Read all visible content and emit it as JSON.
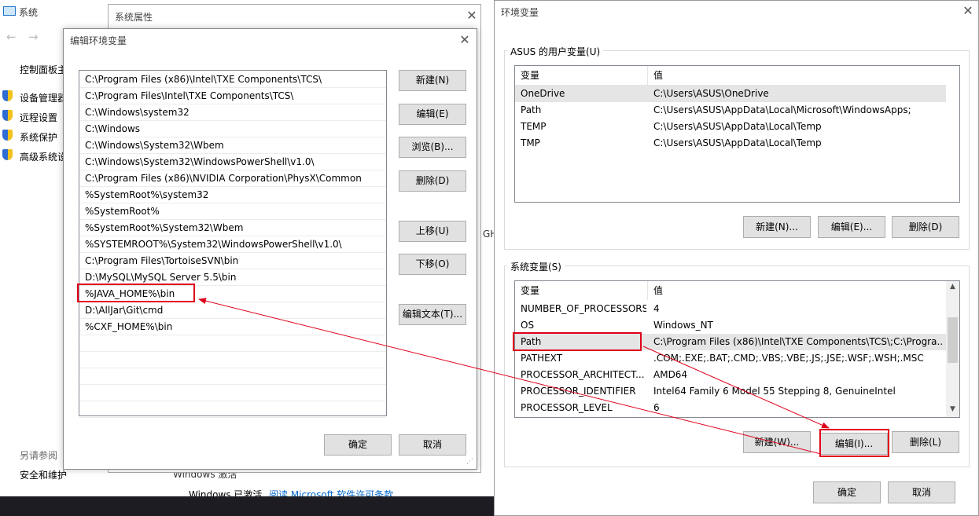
{
  "sysinfo": {
    "title": "系统",
    "breadcrumb": "控制面板主",
    "links": [
      "设备管理器",
      "远程设置",
      "系统保护",
      "高级系统设"
    ],
    "see_also": "另请参阅",
    "security": "安全和维护",
    "activation_partial": "Windows 激活",
    "activated": "Windows 已激活",
    "license_link": "阅读 Microsoft 软件许可条款",
    "partial_right": "GH"
  },
  "sysprops": {
    "title": "系统属性"
  },
  "editdlg": {
    "title": "编辑环境变量",
    "entries": [
      "C:\\Program Files (x86)\\Intel\\TXE Components\\TCS\\",
      "C:\\Program Files\\Intel\\TXE Components\\TCS\\",
      "C:\\Windows\\system32",
      "C:\\Windows",
      "C:\\Windows\\System32\\Wbem",
      "C:\\Windows\\System32\\WindowsPowerShell\\v1.0\\",
      "C:\\Program Files (x86)\\NVIDIA Corporation\\PhysX\\Common",
      "%SystemRoot%\\system32",
      "%SystemRoot%",
      "%SystemRoot%\\System32\\Wbem",
      "%SYSTEMROOT%\\System32\\WindowsPowerShell\\v1.0\\",
      "C:\\Program Files\\TortoiseSVN\\bin",
      "D:\\MySQL\\MySQL Server 5.5\\bin",
      "%JAVA_HOME%\\bin",
      "D:\\AllJar\\Git\\cmd",
      "%CXF_HOME%\\bin"
    ],
    "buttons": {
      "new": "新建(N)",
      "edit": "编辑(E)",
      "browse": "浏览(B)...",
      "delete": "删除(D)",
      "up": "上移(U)",
      "down": "下移(O)",
      "edit_text": "编辑文本(T)...",
      "ok": "确定",
      "cancel": "取消"
    }
  },
  "envdlg": {
    "title": "环境变量",
    "user_group": "ASUS 的用户变量(U)",
    "col_var": "变量",
    "col_val": "值",
    "user_vars": [
      {
        "name": "OneDrive",
        "value": "C:\\Users\\ASUS\\OneDrive"
      },
      {
        "name": "Path",
        "value": "C:\\Users\\ASUS\\AppData\\Local\\Microsoft\\WindowsApps;"
      },
      {
        "name": "TEMP",
        "value": "C:\\Users\\ASUS\\AppData\\Local\\Temp"
      },
      {
        "name": "TMP",
        "value": "C:\\Users\\ASUS\\AppData\\Local\\Temp"
      }
    ],
    "user_buttons": {
      "new": "新建(N)...",
      "edit": "编辑(E)...",
      "delete": "删除(D)"
    },
    "sys_group": "系统变量(S)",
    "sys_vars": [
      {
        "name": "NUMBER_OF_PROCESSORS",
        "value": "4"
      },
      {
        "name": "OS",
        "value": "Windows_NT"
      },
      {
        "name": "Path",
        "value": "C:\\Program Files (x86)\\Intel\\TXE Components\\TCS\\;C:\\Progra..."
      },
      {
        "name": "PATHEXT",
        "value": ".COM;.EXE;.BAT;.CMD;.VBS;.VBE;.JS;.JSE;.WSF;.WSH;.MSC"
      },
      {
        "name": "PROCESSOR_ARCHITECT...",
        "value": "AMD64"
      },
      {
        "name": "PROCESSOR_IDENTIFIER",
        "value": "Intel64 Family 6 Model 55 Stepping 8, GenuineIntel"
      },
      {
        "name": "PROCESSOR_LEVEL",
        "value": "6"
      }
    ],
    "sys_buttons": {
      "new": "新建(W)...",
      "edit": "编辑(I)...",
      "delete": "删除(L)"
    },
    "ok": "确定",
    "cancel": "取消"
  },
  "colors": {
    "annotation": "#e0001a",
    "selected": "#e5e5e5"
  }
}
